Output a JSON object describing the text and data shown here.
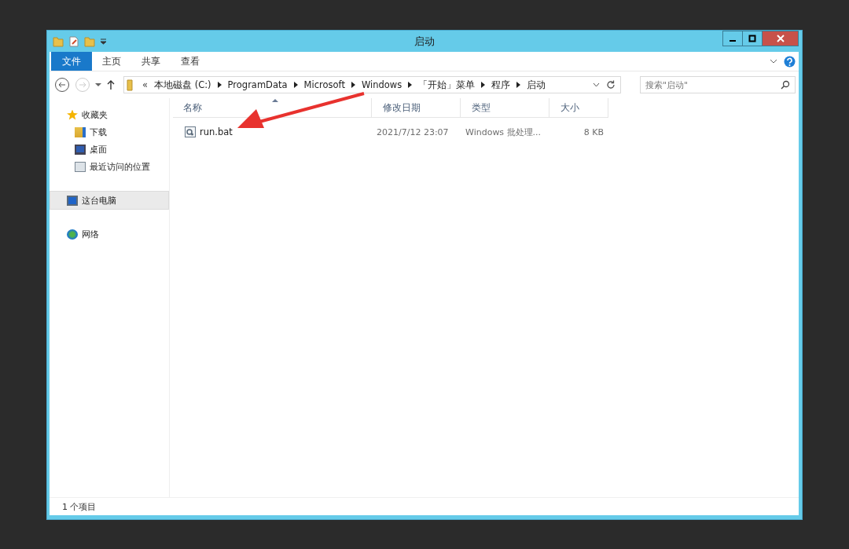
{
  "window": {
    "title": "启动"
  },
  "ribbon_tabs": [
    {
      "label": "文件",
      "kind": "file"
    },
    {
      "label": "主页",
      "kind": "tab"
    },
    {
      "label": "共享",
      "kind": "tab"
    },
    {
      "label": "查看",
      "kind": "tab"
    }
  ],
  "address_bar": {
    "overflow": "«",
    "path": [
      "本地磁盘 (C:)",
      "ProgramData",
      "Microsoft",
      "Windows",
      "「开始」菜单",
      "程序",
      "启动"
    ]
  },
  "search": {
    "placeholder": "搜索\"启动\""
  },
  "sidebar": {
    "items": [
      {
        "label": "收藏夹",
        "selected": false,
        "children": [
          {
            "label": "下载",
            "selected": false
          },
          {
            "label": "桌面",
            "selected": false
          },
          {
            "label": "最近访问的位置",
            "selected": false
          }
        ]
      },
      {
        "label": "这台电脑",
        "selected": true
      },
      {
        "label": "网络",
        "selected": false
      }
    ]
  },
  "table": {
    "columns": [
      {
        "label": "名称",
        "sorted": true
      },
      {
        "label": "修改日期",
        "sorted": false
      },
      {
        "label": "类型",
        "sorted": false
      },
      {
        "label": "大小",
        "sorted": false
      }
    ],
    "rows": [
      {
        "name": "run.bat",
        "modified": "2021/7/12 23:07",
        "type": "Windows 批处理...",
        "size": "8 KB",
        "selected": false
      }
    ]
  },
  "status_bar": {
    "count": "1 个项目"
  }
}
